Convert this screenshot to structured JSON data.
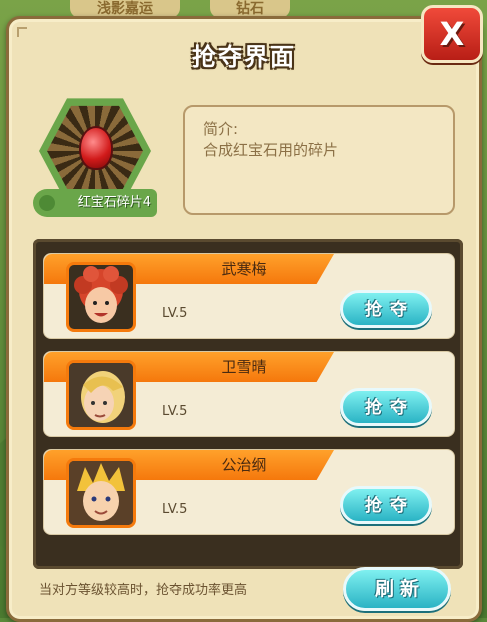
{
  "background": {
    "tabs": [
      "浅影嘉运",
      "钻石"
    ]
  },
  "dialog": {
    "title": "抢夺界面",
    "close_label": "X"
  },
  "item": {
    "name": "红宝石碎片4",
    "icon": "ruby-fragment-icon",
    "desc_title": "简介:",
    "desc_text": "合成红宝石用的碎片"
  },
  "opponents": [
    {
      "name": "武寒梅",
      "level": "LV.5",
      "avatar": "red-hair-girl-avatar",
      "action": "抢夺"
    },
    {
      "name": "卫雪晴",
      "level": "LV.5",
      "avatar": "blonde-woman-avatar",
      "action": "抢夺"
    },
    {
      "name": "公治纲",
      "level": "LV.5",
      "avatar": "spiky-blonde-boy-avatar",
      "action": "抢夺"
    }
  ],
  "footer": {
    "tip": "当对方等级较高时，抢夺成功率更高",
    "refresh_label": "刷新"
  },
  "colors": {
    "panel": "#efe2b8",
    "banner": "#f5780c",
    "action_button": "#2ab3c4",
    "close_button": "#d8261c",
    "frame": "#3a2f1f"
  }
}
